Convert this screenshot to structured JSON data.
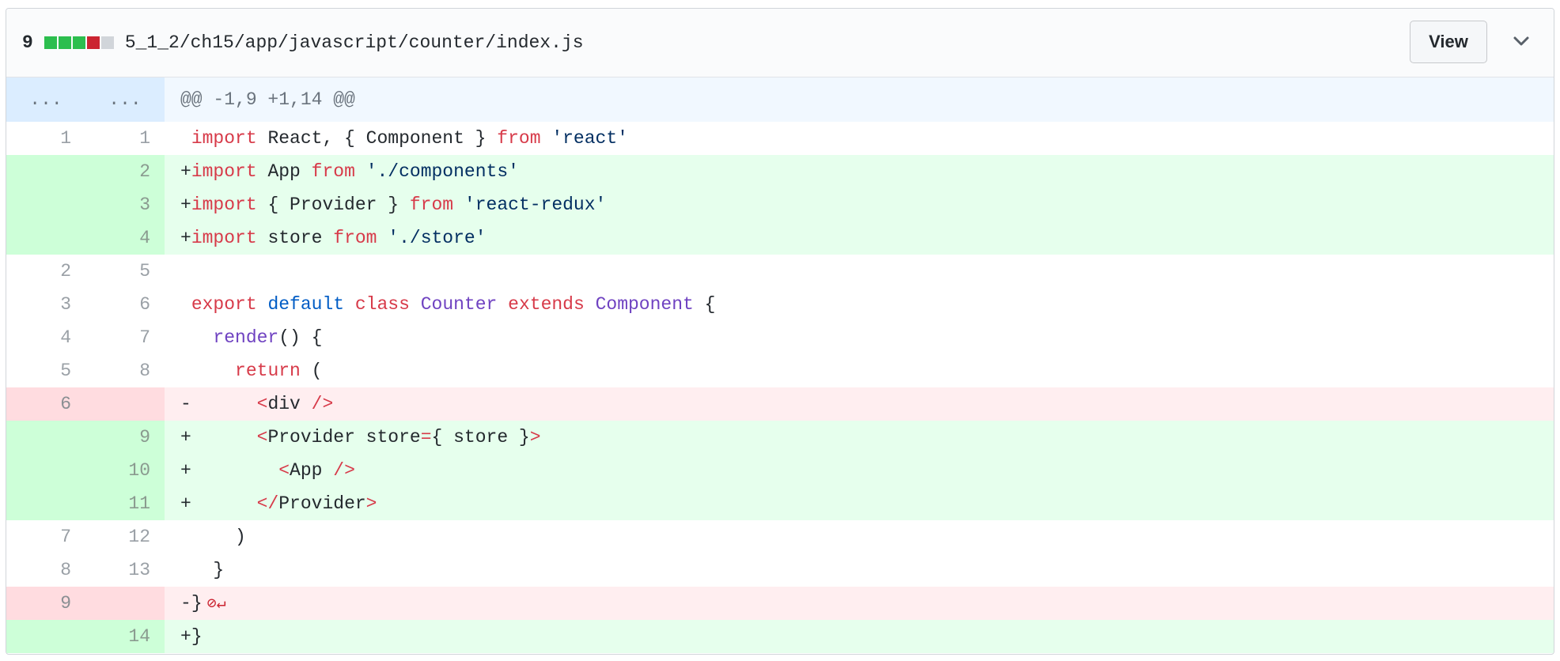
{
  "header": {
    "change_count": "9",
    "diffstat": [
      "#2cbe4e",
      "#2cbe4e",
      "#2cbe4e",
      "#cb2431",
      "#d1d5da"
    ],
    "file_path": "5_1_2/ch15/app/javascript/counter/index.js",
    "view_button_label": "View",
    "collapse_icon": "chevron-down-icon"
  },
  "hunk": {
    "old_expand": "...",
    "new_expand": "...",
    "header": "@@ -1,9 +1,14 @@"
  },
  "colors": {
    "keyword": "#d73a49",
    "string": "#032f62",
    "entity": "#6f42c1",
    "constant": "#005cc5",
    "added_bg": "#e6ffed",
    "deleted_bg": "#ffeef0"
  },
  "lines": [
    {
      "type": "ctx",
      "old": "1",
      "new": "1",
      "marker": " ",
      "tokens": [
        [
          "kw",
          "import"
        ],
        [
          "plain",
          " React, { Component } "
        ],
        [
          "kw",
          "from"
        ],
        [
          "plain",
          " "
        ],
        [
          "str",
          "'react'"
        ]
      ]
    },
    {
      "type": "add",
      "old": "",
      "new": "2",
      "marker": "+",
      "tokens": [
        [
          "kw",
          "import"
        ],
        [
          "plain",
          " App "
        ],
        [
          "kw",
          "from"
        ],
        [
          "plain",
          " "
        ],
        [
          "str",
          "'./components'"
        ]
      ]
    },
    {
      "type": "add",
      "old": "",
      "new": "3",
      "marker": "+",
      "tokens": [
        [
          "kw",
          "import"
        ],
        [
          "plain",
          " { Provider } "
        ],
        [
          "kw",
          "from"
        ],
        [
          "plain",
          " "
        ],
        [
          "str",
          "'react-redux'"
        ]
      ]
    },
    {
      "type": "add",
      "old": "",
      "new": "4",
      "marker": "+",
      "tokens": [
        [
          "kw",
          "import"
        ],
        [
          "plain",
          " store "
        ],
        [
          "kw",
          "from"
        ],
        [
          "plain",
          " "
        ],
        [
          "str",
          "'./store'"
        ]
      ]
    },
    {
      "type": "ctx",
      "old": "2",
      "new": "5",
      "marker": " ",
      "tokens": []
    },
    {
      "type": "ctx",
      "old": "3",
      "new": "6",
      "marker": " ",
      "tokens": [
        [
          "kw",
          "export"
        ],
        [
          "plain",
          " "
        ],
        [
          "const",
          "default"
        ],
        [
          "plain",
          " "
        ],
        [
          "kw",
          "class"
        ],
        [
          "plain",
          " "
        ],
        [
          "ent",
          "Counter"
        ],
        [
          "plain",
          " "
        ],
        [
          "kw",
          "extends"
        ],
        [
          "plain",
          " "
        ],
        [
          "ent",
          "Component"
        ],
        [
          "plain",
          " {"
        ]
      ]
    },
    {
      "type": "ctx",
      "old": "4",
      "new": "7",
      "marker": " ",
      "tokens": [
        [
          "plain",
          "  "
        ],
        [
          "ent",
          "render"
        ],
        [
          "plain",
          "() {"
        ]
      ]
    },
    {
      "type": "ctx",
      "old": "5",
      "new": "8",
      "marker": " ",
      "tokens": [
        [
          "plain",
          "    "
        ],
        [
          "kw",
          "return"
        ],
        [
          "plain",
          " ("
        ]
      ]
    },
    {
      "type": "del",
      "old": "6",
      "new": "",
      "marker": "-",
      "tokens": [
        [
          "plain",
          "      "
        ],
        [
          "tag",
          "<"
        ],
        [
          "plain",
          "div "
        ],
        [
          "tag",
          "/>"
        ]
      ]
    },
    {
      "type": "add",
      "old": "",
      "new": "9",
      "marker": "+",
      "tokens": [
        [
          "plain",
          "      "
        ],
        [
          "tag",
          "<"
        ],
        [
          "plain",
          "Provider store"
        ],
        [
          "tag",
          "="
        ],
        [
          "plain",
          "{ store }"
        ],
        [
          "tag",
          ">"
        ]
      ]
    },
    {
      "type": "add",
      "old": "",
      "new": "10",
      "marker": "+",
      "tokens": [
        [
          "plain",
          "        "
        ],
        [
          "tag",
          "<"
        ],
        [
          "plain",
          "App "
        ],
        [
          "tag",
          "/>"
        ]
      ]
    },
    {
      "type": "add",
      "old": "",
      "new": "11",
      "marker": "+",
      "tokens": [
        [
          "plain",
          "      "
        ],
        [
          "tag",
          "</"
        ],
        [
          "plain",
          "Provider"
        ],
        [
          "tag",
          ">"
        ]
      ]
    },
    {
      "type": "ctx",
      "old": "7",
      "new": "12",
      "marker": " ",
      "tokens": [
        [
          "plain",
          "    )"
        ]
      ]
    },
    {
      "type": "ctx",
      "old": "8",
      "new": "13",
      "marker": " ",
      "tokens": [
        [
          "plain",
          "  }"
        ]
      ]
    },
    {
      "type": "del",
      "old": "9",
      "new": "",
      "marker": "-",
      "tokens": [
        [
          "plain",
          "}"
        ]
      ],
      "no_newline": "⊘↵"
    },
    {
      "type": "add",
      "old": "",
      "new": "14",
      "marker": "+",
      "tokens": [
        [
          "plain",
          "}"
        ]
      ]
    }
  ]
}
